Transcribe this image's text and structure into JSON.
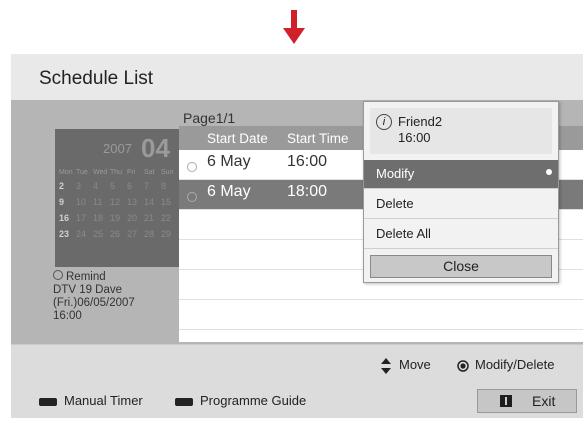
{
  "screen": {
    "title": "Schedule List",
    "page": "Page1/1"
  },
  "calendar": {
    "year": "2007",
    "month": "04",
    "weekdays": [
      "Mon",
      "Tue",
      "Wed",
      "Thu",
      "Fri",
      "Sat",
      "Sun"
    ],
    "weeks": [
      [
        "2",
        "3",
        "4",
        "5",
        "6",
        "7",
        "8"
      ],
      [
        "9",
        "10",
        "11",
        "12",
        "13",
        "14",
        "15"
      ],
      [
        "16",
        "17",
        "18",
        "19",
        "20",
        "21",
        "22"
      ],
      [
        "23",
        "24",
        "25",
        "26",
        "27",
        "28",
        "29"
      ]
    ]
  },
  "remind": {
    "label": "Remind",
    "channel": "DTV 19 Dave",
    "date": "(Fri.)06/05/2007",
    "time": "16:00"
  },
  "list": {
    "headers": {
      "start_date": "Start Date",
      "start_time": "Start Time"
    },
    "rows": [
      {
        "date": "6 May",
        "time": "16:00"
      },
      {
        "date": "6 May",
        "time": "18:00"
      }
    ]
  },
  "popup": {
    "info_icon": "i",
    "name": "Friend2",
    "time": "16:00",
    "items": [
      "Modify",
      "Delete",
      "Delete All"
    ],
    "close": "Close"
  },
  "footer": {
    "move": "Move",
    "modify_delete": "Modify/Delete",
    "manual_timer": "Manual Timer",
    "programme_guide": "Programme Guide",
    "exit": "Exit"
  },
  "colors": {
    "accent": "#d0202a",
    "selected": "#6e6e6e"
  }
}
